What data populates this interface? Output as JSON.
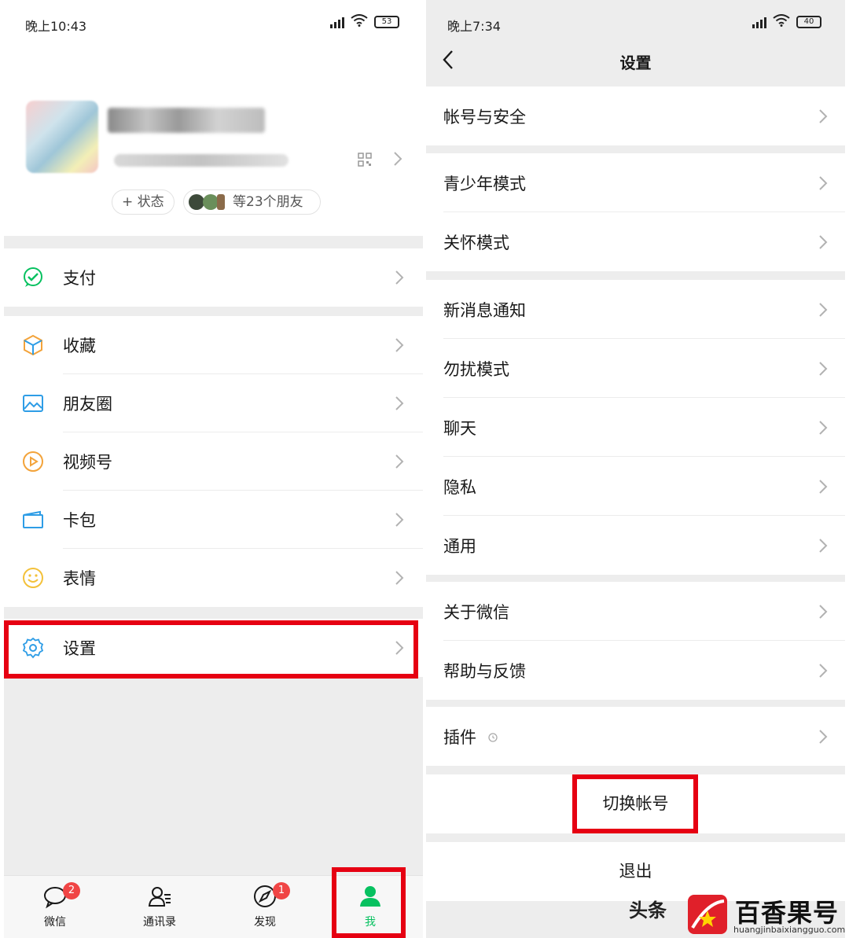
{
  "left": {
    "status": {
      "time": "晚上10:43",
      "battery": "53"
    },
    "profile": {
      "status_pill": "+ 状态",
      "friends_pill": "等23个朋友"
    },
    "rows": [
      {
        "label": "支付",
        "icon": "wechat-pay-icon"
      },
      {
        "label": "收藏",
        "icon": "favorites-cube-icon"
      },
      {
        "label": "朋友圈",
        "icon": "moments-photo-icon"
      },
      {
        "label": "视频号",
        "icon": "channels-play-icon"
      },
      {
        "label": "卡包",
        "icon": "card-wallet-icon"
      },
      {
        "label": "表情",
        "icon": "sticker-smile-icon"
      },
      {
        "label": "设置",
        "icon": "gear-icon"
      }
    ],
    "tabs": [
      {
        "label": "微信",
        "badge": "2",
        "active": false
      },
      {
        "label": "通讯录",
        "badge": "",
        "active": false
      },
      {
        "label": "发现",
        "badge": "1",
        "active": false
      },
      {
        "label": "我",
        "badge": "",
        "active": true
      }
    ]
  },
  "right": {
    "status": {
      "time": "晚上7:34",
      "battery": "40"
    },
    "title": "设置",
    "groups": [
      [
        "帐号与安全"
      ],
      [
        "青少年模式",
        "关怀模式"
      ],
      [
        "新消息通知",
        "勿扰模式",
        "聊天",
        "隐私",
        "通用"
      ],
      [
        "关于微信",
        "帮助与反馈"
      ],
      [
        "插件"
      ]
    ],
    "switch_account": "切换帐号",
    "logout": "退出"
  },
  "watermark": {
    "prefix": "头条",
    "brand": "百香果号",
    "url": "huangjinbaixiangguo.com"
  },
  "colors": {
    "wechat_green": "#07c160",
    "highlight_red": "#e60012",
    "background": "#ededed",
    "badge_red": "#f04545"
  }
}
